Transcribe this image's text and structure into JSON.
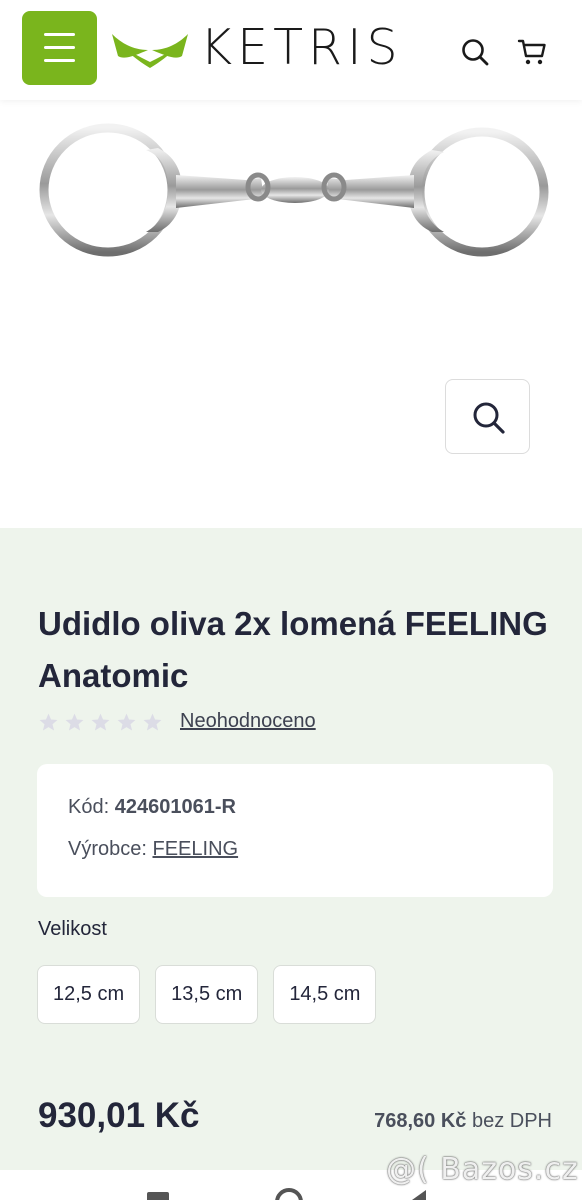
{
  "header": {
    "logo_text": "KETRIS",
    "menu_icon": "hamburger-menu-icon",
    "search_icon": "search-icon",
    "cart_icon": "cart-icon",
    "accent_color": "#7ab51d"
  },
  "gallery": {
    "image": "product-bit-image",
    "zoom_icon": "zoom-search-icon"
  },
  "product": {
    "title": "Udidlo oliva 2x lomená FEELING Anatomic",
    "rating_count": 5,
    "rating_value": 0,
    "rating_link": "Neohodnoceno",
    "code_label": "Kód:",
    "code_value": "424601061-R",
    "maker_label": "Výrobce:",
    "maker_value": "FEELING",
    "size_label": "Velikost",
    "sizes": [
      "12,5 cm",
      "13,5 cm",
      "14,5 cm"
    ],
    "price": "930,01 Kč",
    "price_net_value": "768,60 Kč",
    "price_net_suffix": "bez DPH"
  },
  "watermark": "@( Bazos.cz",
  "colors": {
    "info_bg": "#eef4ec",
    "star": "#dcdce6"
  }
}
